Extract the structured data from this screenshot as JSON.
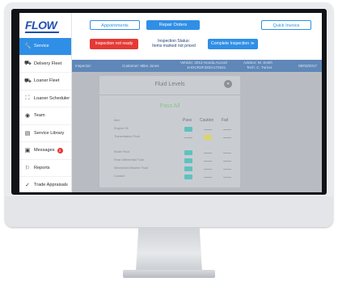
{
  "sidebar": {
    "logo": "FLOW",
    "items": [
      {
        "label": "Service",
        "icon": "wrench-icon",
        "glyph": "🔧",
        "active": true
      },
      {
        "label": "Delivery Fleet",
        "icon": "car-icon",
        "glyph": "⛟"
      },
      {
        "label": "Loaner Fleet",
        "icon": "car-icon",
        "glyph": "⛟"
      },
      {
        "label": "Loaner Scheduler",
        "icon": "scheduler-icon",
        "glyph": "⛶"
      },
      {
        "label": "Team",
        "icon": "team-icon",
        "glyph": "◉"
      },
      {
        "label": "Service Library",
        "icon": "library-icon",
        "glyph": "▤"
      },
      {
        "label": "Messages",
        "icon": "messages-icon",
        "glyph": "▣",
        "badge": "2"
      },
      {
        "label": "Reports",
        "icon": "flag-icon",
        "glyph": "⚐"
      },
      {
        "label": "Trade Appraisals",
        "icon": "check-icon",
        "glyph": "✓"
      }
    ]
  },
  "top_buttons": {
    "appointments": "Appointments",
    "repair_orders": "Repair Orders",
    "quick_invoice": "Quick Invoice"
  },
  "status": {
    "inspection_button": "Inspection not ready",
    "status_line1": "Inspection Status:",
    "status_line2": "Items marked not priced",
    "complete_button": "Complete Inspection ≫"
  },
  "infobar": {
    "inspector": "Inspector:",
    "customer": "Customer: Mike Jones",
    "vehicle_line1": "Vehicle: 2013 Honda Accord",
    "vehicle_line2": "1HGCR2F32DA173341",
    "advisor_line1": "Advisor: M. Smith",
    "advisor_line2": "Tech: C. Turner",
    "date": "08/03/2017"
  },
  "card": {
    "title": "Fluid Levels",
    "result": "Pass All",
    "columns": {
      "item": "Item",
      "pass": "Pass",
      "caution": "Caution",
      "fail": "Fail"
    },
    "rows": [
      {
        "label": "Engine Oil",
        "status": "pass"
      },
      {
        "label": "Transmission Fluid",
        "status": "caution"
      },
      {
        "label": "",
        "status": "none"
      },
      {
        "label": "Brake Fluid",
        "status": "pass"
      },
      {
        "label": "Rear Differential Fluid",
        "status": "pass"
      },
      {
        "label": "Windshield Washer Fluid",
        "status": "pass"
      },
      {
        "label": "Coolant",
        "status": "pass"
      }
    ]
  },
  "colors": {
    "accent": "#2f8fe6",
    "alert": "#e53935",
    "infobar": "#5f87b8",
    "pass": "#5fc2c0",
    "caution": "#ddd36a"
  }
}
